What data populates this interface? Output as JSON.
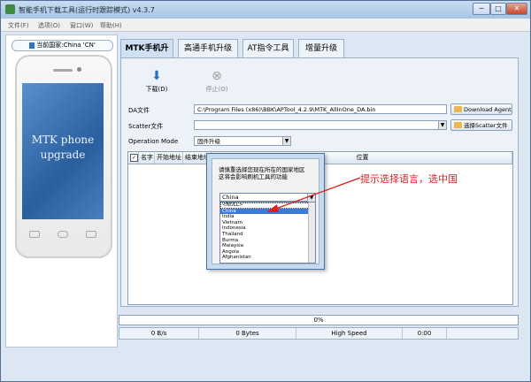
{
  "window": {
    "title": "智能手机下载工具(运行时跟踪模式)  v4.3.7",
    "minimize_label": "─",
    "maximize_label": "□",
    "close_label": "✕"
  },
  "menu": [
    "文件(F)",
    "选项(O)",
    "窗口(W)",
    "帮助(H)"
  ],
  "left_panel": {
    "country": "当前国家:China 'CN'",
    "phone_screen_text": "MTK phone\nupgrade"
  },
  "tabs": [
    {
      "label": "MTK手机升级",
      "active": true
    },
    {
      "label": "高通手机升级",
      "active": false
    },
    {
      "label": "AT指令工具",
      "active": false
    },
    {
      "label": "增量升级",
      "active": false
    }
  ],
  "toolbar": {
    "download_label": "下载(D)",
    "download_icon": "arrow-down-icon",
    "stop_label": "停止(O)",
    "stop_icon": "stop-icon"
  },
  "form": {
    "da_label": "DA文件",
    "da_value": "C:\\Program Files (x86)\\BBK\\APTool_4.2.9\\MTK_AllInOne_DA.bin",
    "download_agent_label": "Download Agent",
    "scatter_label": "Scatter文件",
    "scatter_value": "",
    "scatter_button_label": "选择Scatter文件",
    "operation_label": "Operation Mode",
    "operation_value": "固件升级"
  },
  "table": {
    "check_mark": "✓",
    "columns": [
      "名字",
      "开始地址",
      "结束地址",
      "位置"
    ]
  },
  "dialog": {
    "message": "请慎重选择您现在所在的国家地区\n这将会影响刷机工具的功能",
    "selected": "China",
    "options": [
      "<NULL>",
      "China",
      "India",
      "Vietnam",
      "Indonesia",
      "Thailand",
      "Burma",
      "Malaysia",
      "Angola",
      "Afghanistan"
    ],
    "highlighted_index": 1
  },
  "annotation": {
    "text": "提示选择语言，选中国",
    "color": "#e01f1f"
  },
  "progress": {
    "percent_text": "0%"
  },
  "status": {
    "speed": "0 B/s",
    "size": "0 Bytes",
    "mode": "High Speed",
    "time": "0:00"
  }
}
